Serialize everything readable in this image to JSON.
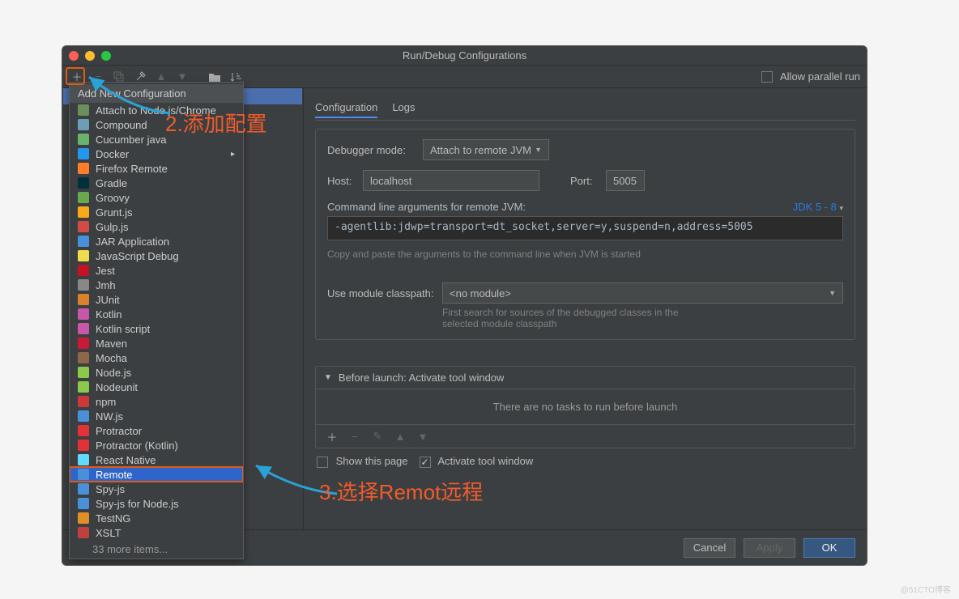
{
  "window": {
    "title": "Run/Debug Configurations"
  },
  "toolbar": {
    "allow_parallel_label": "Allow parallel run"
  },
  "popup": {
    "title": "Add New Configuration",
    "items": [
      {
        "label": "Attach to Node.js/Chrome",
        "icon": "#6B8E5A"
      },
      {
        "label": "Compound",
        "icon": "#6e9db8"
      },
      {
        "label": "Cucumber java",
        "icon": "#69b36e"
      },
      {
        "label": "Docker",
        "icon": "#2496ed",
        "submenu": true
      },
      {
        "label": "Firefox Remote",
        "icon": "#ff7c2a"
      },
      {
        "label": "Gradle",
        "icon": "#02303a"
      },
      {
        "label": "Groovy",
        "icon": "#6aa84f"
      },
      {
        "label": "Grunt.js",
        "icon": "#fba919"
      },
      {
        "label": "Gulp.js",
        "icon": "#d34a47"
      },
      {
        "label": "JAR Application",
        "icon": "#4a90d9"
      },
      {
        "label": "JavaScript Debug",
        "icon": "#f0db4f"
      },
      {
        "label": "Jest",
        "icon": "#c21325"
      },
      {
        "label": "Jmh",
        "icon": "#888888"
      },
      {
        "label": "JUnit",
        "icon": "#d9822b"
      },
      {
        "label": "Kotlin",
        "icon": "#c757a8"
      },
      {
        "label": "Kotlin script",
        "icon": "#c757a8"
      },
      {
        "label": "Maven",
        "icon": "#c71a36"
      },
      {
        "label": "Mocha",
        "icon": "#8d6748"
      },
      {
        "label": "Node.js",
        "icon": "#8cc84b"
      },
      {
        "label": "Nodeunit",
        "icon": "#8cc84b"
      },
      {
        "label": "npm",
        "icon": "#cb3837"
      },
      {
        "label": "NW.js",
        "icon": "#4a90d9"
      },
      {
        "label": "Protractor",
        "icon": "#e23237"
      },
      {
        "label": "Protractor (Kotlin)",
        "icon": "#e23237"
      },
      {
        "label": "React Native",
        "icon": "#61dafb"
      },
      {
        "label": "Remote",
        "icon": "#4a90d9",
        "selected": true
      },
      {
        "label": "Spy-js",
        "icon": "#4a90d9"
      },
      {
        "label": "Spy-js for Node.js",
        "icon": "#4a90d9"
      },
      {
        "label": "TestNG",
        "icon": "#e08e27"
      },
      {
        "label": "XSLT",
        "icon": "#c04040"
      }
    ],
    "more": "33 more items..."
  },
  "tabs": {
    "configuration": "Configuration",
    "logs": "Logs"
  },
  "config": {
    "debugger_mode_label": "Debugger mode:",
    "debugger_mode_value": "Attach to remote JVM",
    "host_label": "Host:",
    "host_value": "localhost",
    "port_label": "Port:",
    "port_value": "5005",
    "args_label": "Command line arguments for remote JVM:",
    "jdk_link": "JDK 5 - 8",
    "args_value": "-agentlib:jdwp=transport=dt_socket,server=y,suspend=n,address=5005",
    "args_hint": "Copy and paste the arguments to the command line when JVM is started",
    "module_label": "Use module classpath:",
    "module_value": "<no module>",
    "module_hint": "First search for sources of the debugged classes in the selected module classpath"
  },
  "before_launch": {
    "header": "Before launch: Activate tool window",
    "empty": "There are no tasks to run before launch"
  },
  "options": {
    "show_page": "Show this page",
    "activate": "Activate tool window"
  },
  "footer": {
    "cancel": "Cancel",
    "apply": "Apply",
    "ok": "OK"
  },
  "annotations": {
    "step2": "2.添加配置",
    "step3": "3.选择Remot远程"
  },
  "watermark": "@51CTO博客"
}
